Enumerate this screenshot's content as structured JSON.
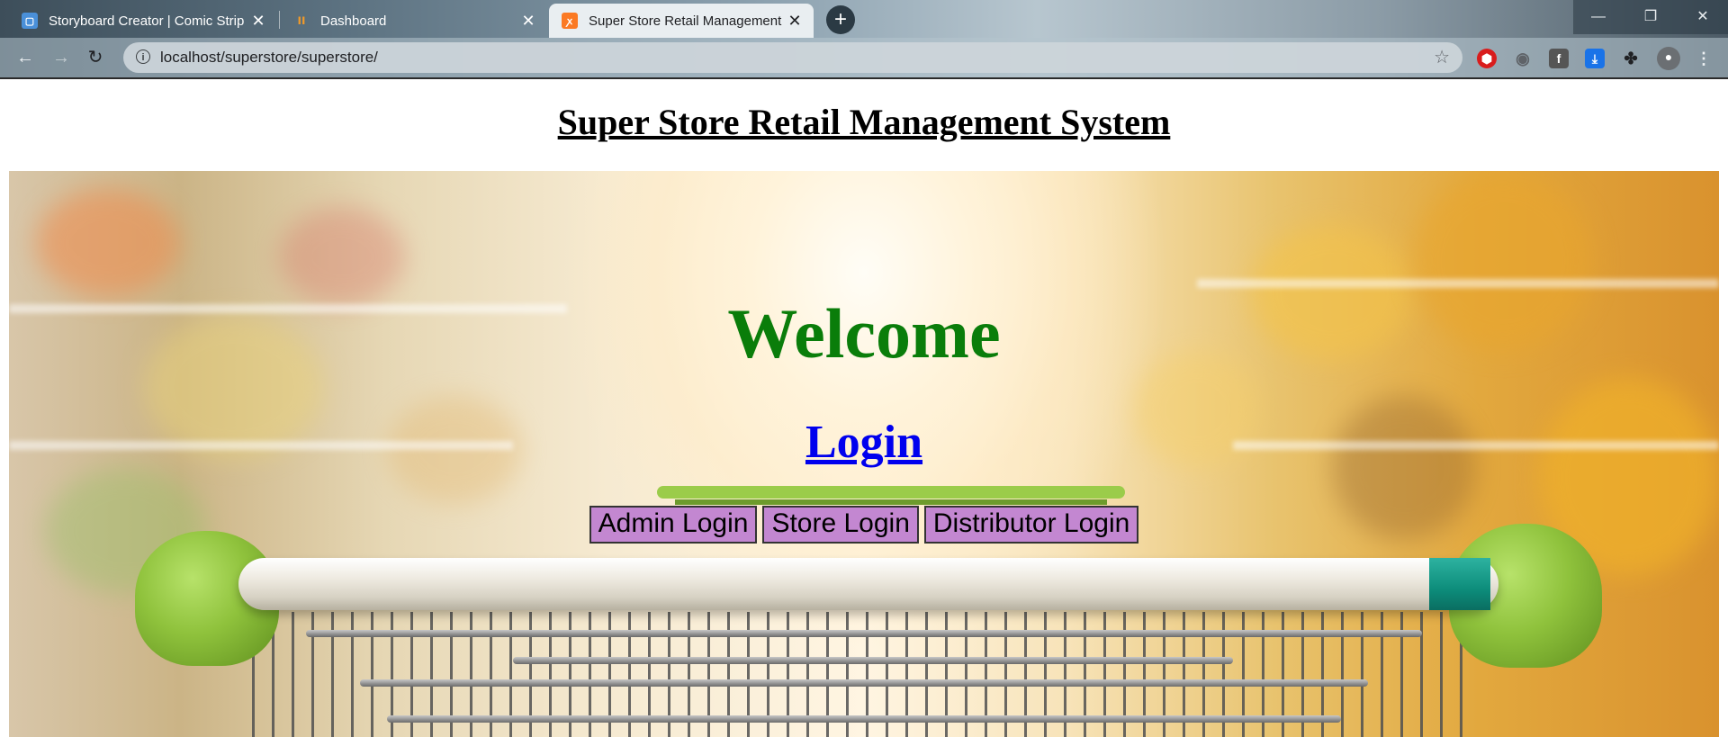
{
  "browser": {
    "tabs": [
      {
        "title": "Storyboard Creator | Comic Strip",
        "icon": "storyboard-icon",
        "active": false
      },
      {
        "title": "Dashboard",
        "icon": "dashboard-icon",
        "active": false
      },
      {
        "title": "Super Store Retail Management",
        "icon": "xampp-icon",
        "active": true
      }
    ],
    "url": "localhost/superstore/superstore/",
    "colors": {
      "active_tab": "#e9eef1",
      "toolbar_bg": "#8ea3b1"
    }
  },
  "page": {
    "title": "Super Store Retail Management System",
    "welcome": "Welcome",
    "login_heading": "Login",
    "buttons": {
      "admin": "Admin Login",
      "store": "Store Login",
      "distributor": "Distributor Login"
    },
    "colors": {
      "welcome": "#0a7d0a",
      "link": "#0000ee",
      "button_bg": "#c387d1"
    }
  }
}
